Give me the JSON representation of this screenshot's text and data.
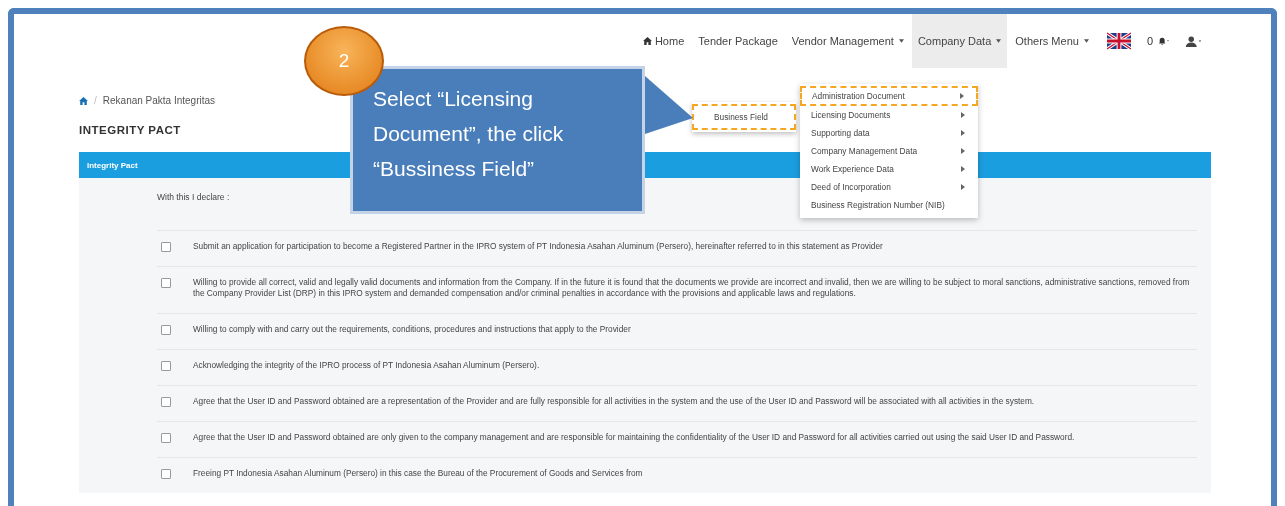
{
  "navbar": {
    "items": [
      {
        "label": "Home",
        "kind": "home",
        "selected": false
      },
      {
        "label": "Tender Package",
        "kind": "link",
        "selected": false
      },
      {
        "label": "Vendor Management",
        "kind": "dropdown",
        "selected": false
      },
      {
        "label": "Company Data",
        "kind": "dropdown",
        "selected": true
      },
      {
        "label": "Others Menu",
        "kind": "dropdown",
        "selected": false
      }
    ],
    "notifications": "0"
  },
  "breadcrumb_separator": "/",
  "breadcrumb": "Rekanan Pakta Integritas",
  "page_title": "INTEGRITY PACT",
  "panel": {
    "title": "Integrity Pact",
    "intro": "With this I declare :",
    "statements": [
      {
        "text": "Submit an application for participation to become a Registered Partner in the IPRO system of PT Indonesia Asahan Aluminum (Persero), hereinafter referred to in this statement as Provider",
        "checked": false
      },
      {
        "text": "Willing to provide all correct, valid and legally valid documents and information from the Company. If in the future it is found that the documents we provide are incorrect and invalid, then we are willing to be subject to moral sanctions, administrative sanctions, removed from the Company Provider List (DRP) in this IPRO system and demanded compensation and/or criminal penalties in accordance with the provisions and applicable laws and regulations.",
        "checked": false
      },
      {
        "text": "Willing to comply with and carry out the requirements, conditions, procedures and instructions that apply to the Provider",
        "checked": false
      },
      {
        "text": "Acknowledging the integrity of the IPRO process of PT Indonesia Asahan Aluminum (Persero).",
        "checked": false
      },
      {
        "text": "Agree that the User ID and Password obtained are a representation of the Provider and are fully responsible for all activities in the system and the use of the User ID and Password will be associated with all activities in the system.",
        "checked": false
      },
      {
        "text": "Agree that the User ID and Password obtained are only given to the company management and are responsible for maintaining the confidentiality of the User ID and Password for all activities carried out using the said User ID and Password.",
        "checked": false
      },
      {
        "text": "Freeing PT Indonesia Asahan Aluminum (Persero) in this case the Bureau of the Procurement of Goods and Services from",
        "checked": false
      }
    ]
  },
  "dropdown": {
    "items": [
      {
        "label": "Administration Document",
        "submenu": true,
        "highlighted": true
      },
      {
        "label": "Licensing Documents",
        "submenu": true,
        "highlighted": false
      },
      {
        "label": "Supporting data",
        "submenu": true,
        "highlighted": false
      },
      {
        "label": "Company Management Data",
        "submenu": true,
        "highlighted": false
      },
      {
        "label": "Work Experience Data",
        "submenu": true,
        "highlighted": false
      },
      {
        "label": "Deed of Incorporation",
        "submenu": true,
        "highlighted": false
      },
      {
        "label": "Business Registration Number (NIB)",
        "submenu": false,
        "highlighted": false
      }
    ]
  },
  "submenu": {
    "items": [
      {
        "label": "Business Field",
        "highlighted": true
      }
    ]
  },
  "callout": {
    "step": "2",
    "text": "Select “Licensing Document”, the click “Bussiness Field”"
  }
}
